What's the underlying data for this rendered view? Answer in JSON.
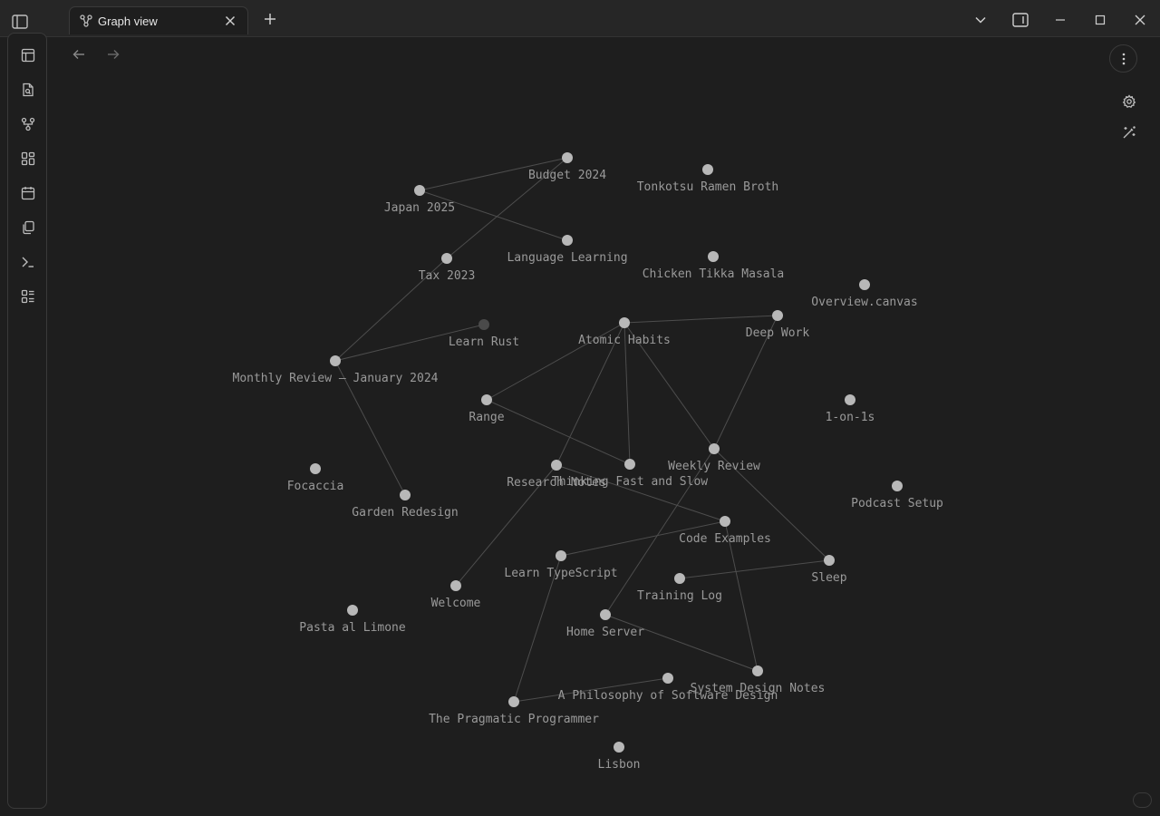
{
  "tab": {
    "label": "Graph view"
  },
  "graph": {
    "nodes": [
      {
        "id": "budget-2024",
        "label": "Budget 2024"
      },
      {
        "id": "tonkotsu",
        "label": "Tonkotsu Ramen Broth"
      },
      {
        "id": "japan-2025",
        "label": "Japan 2025"
      },
      {
        "id": "language-learning",
        "label": "Language Learning"
      },
      {
        "id": "tax-2023",
        "label": "Tax 2023"
      },
      {
        "id": "chicken-tikka",
        "label": "Chicken Tikka Masala"
      },
      {
        "id": "overview-canvas",
        "label": "Overview.canvas"
      },
      {
        "id": "learn-rust",
        "label": "Learn Rust",
        "unresolved": true
      },
      {
        "id": "atomic-habits",
        "label": "Atomic Habits"
      },
      {
        "id": "deep-work",
        "label": "Deep Work"
      },
      {
        "id": "monthly-review",
        "label": "Monthly Review — January 2024"
      },
      {
        "id": "range",
        "label": "Range"
      },
      {
        "id": "one-on-ones",
        "label": "1-on-1s"
      },
      {
        "id": "weekly-review",
        "label": "Weekly Review"
      },
      {
        "id": "research-notes",
        "label": "Research Notes"
      },
      {
        "id": "thinking-fast",
        "label": "Thinking Fast and Slow"
      },
      {
        "id": "focaccia",
        "label": "Focaccia"
      },
      {
        "id": "garden-redesign",
        "label": "Garden Redesign"
      },
      {
        "id": "podcast-setup",
        "label": "Podcast Setup"
      },
      {
        "id": "code-examples",
        "label": "Code Examples"
      },
      {
        "id": "learn-typescript",
        "label": "Learn TypeScript"
      },
      {
        "id": "sleep",
        "label": "Sleep"
      },
      {
        "id": "training-log",
        "label": "Training Log"
      },
      {
        "id": "welcome",
        "label": "Welcome"
      },
      {
        "id": "pasta-limone",
        "label": "Pasta al Limone"
      },
      {
        "id": "home-server",
        "label": "Home Server"
      },
      {
        "id": "system-design",
        "label": "System Design Notes"
      },
      {
        "id": "philosophy-sd",
        "label": "A Philosophy of Software Design"
      },
      {
        "id": "pragmatic-programmer",
        "label": "The Pragmatic Programmer"
      },
      {
        "id": "lisbon",
        "label": "Lisbon"
      }
    ],
    "links": [
      [
        "japan-2025",
        "budget-2024"
      ],
      [
        "japan-2025",
        "language-learning"
      ],
      [
        "tax-2023",
        "budget-2024"
      ],
      [
        "monthly-review",
        "tax-2023"
      ],
      [
        "monthly-review",
        "learn-rust"
      ],
      [
        "monthly-review",
        "garden-redesign"
      ],
      [
        "atomic-habits",
        "deep-work"
      ],
      [
        "atomic-habits",
        "range"
      ],
      [
        "atomic-habits",
        "thinking-fast"
      ],
      [
        "atomic-habits",
        "research-notes"
      ],
      [
        "atomic-habits",
        "weekly-review"
      ],
      [
        "deep-work",
        "weekly-review"
      ],
      [
        "range",
        "thinking-fast"
      ],
      [
        "research-notes",
        "code-examples"
      ],
      [
        "research-notes",
        "welcome"
      ],
      [
        "weekly-review",
        "sleep"
      ],
      [
        "weekly-review",
        "home-server"
      ],
      [
        "code-examples",
        "learn-typescript"
      ],
      [
        "code-examples",
        "system-design"
      ],
      [
        "training-log",
        "sleep"
      ],
      [
        "learn-typescript",
        "pragmatic-programmer"
      ],
      [
        "home-server",
        "system-design"
      ],
      [
        "pragmatic-programmer",
        "philosophy-sd"
      ]
    ]
  },
  "colors": {
    "node": "#b8b8b8",
    "node_unresolved": "#4a4a4a",
    "link": "#4d4d4d",
    "label": "#9a9a9a",
    "background": "#1e1e1e"
  },
  "icons": {
    "ribbon": [
      "open-quick-switcher-icon",
      "search-files-icon",
      "graph-view-icon",
      "canvas-icon",
      "daily-note-icon",
      "templates-icon",
      "command-palette-icon",
      "bases-icon"
    ],
    "titlebar": [
      "sidebar-toggle-icon",
      "graph-tab-icon",
      "close-tab-icon",
      "new-tab-icon",
      "tab-list-chevron-icon",
      "right-sidebar-toggle-icon",
      "minimize-icon",
      "maximize-icon",
      "close-window-icon"
    ]
  }
}
